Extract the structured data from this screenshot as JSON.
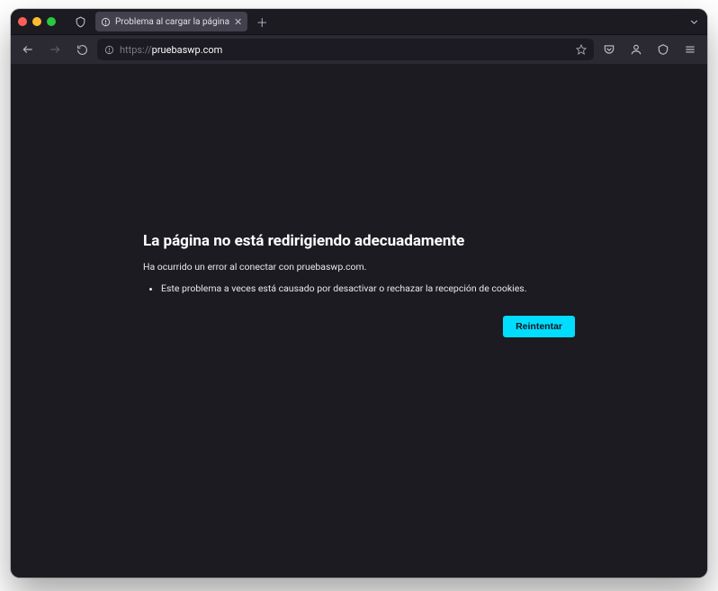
{
  "tab": {
    "title": "Problema al cargar la página"
  },
  "url": {
    "protocol": "https://",
    "host": "pruebaswp.com"
  },
  "error": {
    "title": "La página no está redirigiendo adecuadamente",
    "subtitle": "Ha ocurrido un error al conectar con pruebaswp.com.",
    "bullet1": "Este problema a veces está causado por desactivar o rechazar la recepción de cookies.",
    "retry_label": "Reintentar"
  }
}
